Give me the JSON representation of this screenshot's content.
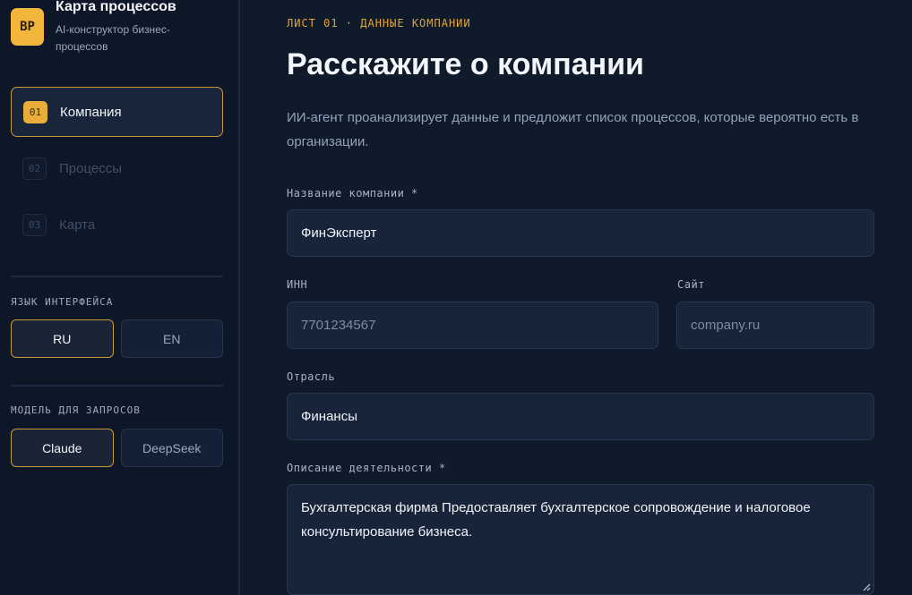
{
  "brand": {
    "logo_text": "BP",
    "title": "Карта процессов",
    "subtitle": "AI-конструктор бизнес-процессов"
  },
  "steps": [
    {
      "num": "01",
      "label": "Компания",
      "active": true
    },
    {
      "num": "02",
      "label": "Процессы",
      "active": false
    },
    {
      "num": "03",
      "label": "Карта",
      "active": false
    }
  ],
  "language": {
    "label": "ЯЗЫК ИНТЕРФЕЙСА",
    "options": [
      "RU",
      "EN"
    ],
    "selected": "RU"
  },
  "model": {
    "label": "МОДЕЛЬ ДЛЯ ЗАПРОСОВ",
    "options": [
      "Claude",
      "DeepSeek"
    ],
    "selected": "Claude"
  },
  "main": {
    "eyebrow": "ЛИСТ 01 · ДАННЫЕ КОМПАНИИ",
    "heading": "Расскажите о компании",
    "lead": "ИИ-агент проанализирует данные и предложит список процессов, которые вероятно есть в организации."
  },
  "form": {
    "company_name": {
      "label": "Название компании *",
      "value": "ФинЭксперт"
    },
    "inn": {
      "label": "ИНН",
      "placeholder": "7701234567"
    },
    "site": {
      "label": "Сайт",
      "placeholder": "company.ru"
    },
    "industry": {
      "label": "Отрасль",
      "value": "Финансы"
    },
    "description": {
      "label": "Описание деятельности *",
      "value": "Бухгалтерская фирма Предоставляет бухгалтерское сопровождение и налоговое консультирование бизнеса."
    }
  },
  "colors": {
    "accent": "#e9ae3a",
    "background": "#0f1a2b",
    "sidebar": "#0d1727",
    "input_bg": "#18243a"
  }
}
